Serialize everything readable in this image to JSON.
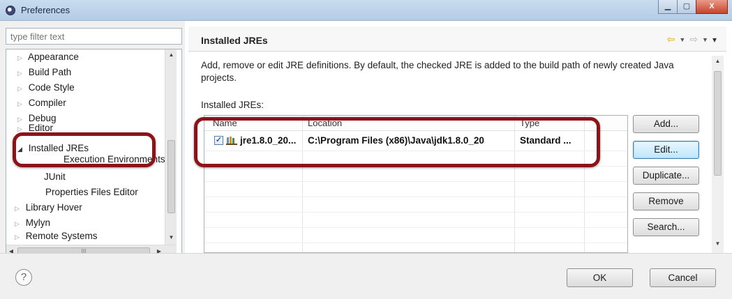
{
  "window": {
    "title": "Preferences",
    "minimize": "▁",
    "maximize": "▢",
    "close": "X"
  },
  "filter": {
    "placeholder": "type filter text"
  },
  "tree": {
    "items": [
      {
        "label": "Appearance",
        "expander": "▷"
      },
      {
        "label": "Build Path",
        "expander": "▷"
      },
      {
        "label": "Code Style",
        "expander": "▷"
      },
      {
        "label": "Compiler",
        "expander": "▷"
      },
      {
        "label": "Debug",
        "expander": "▷"
      },
      {
        "label": "Editor",
        "expander": "▷"
      },
      {
        "label": "Installed JREs",
        "expander": "◢"
      },
      {
        "label": "Execution Environments",
        "expander": ""
      },
      {
        "label": "JUnit",
        "expander": ""
      },
      {
        "label": "Properties Files Editor",
        "expander": ""
      },
      {
        "label": "Library Hover",
        "expander": "▷"
      },
      {
        "label": "Mylyn",
        "expander": "▷"
      },
      {
        "label": "Remote Systems",
        "expander": "▷"
      }
    ],
    "hscroll_grip": "III"
  },
  "page": {
    "title": "Installed JREs",
    "description": "Add, remove or edit JRE definitions. By default, the checked JRE is added to the build path of newly created Java projects.",
    "list_label": "Installed JREs:"
  },
  "table": {
    "columns": [
      "Name",
      "Location",
      "Type"
    ],
    "rows": [
      {
        "checked": "✓",
        "name": "jre1.8.0_20...",
        "location": "C:\\Program Files (x86)\\Java\\jdk1.8.0_20",
        "type": "Standard ..."
      }
    ]
  },
  "buttons": {
    "add": "Add...",
    "edit": "Edit...",
    "duplicate": "Duplicate...",
    "remove": "Remove",
    "search": "Search..."
  },
  "footer": {
    "help": "?",
    "ok": "OK",
    "cancel": "Cancel"
  },
  "colors": {
    "highlight": "#8c1318",
    "back_arrow": "#e2a800"
  },
  "icons": {
    "back": "⇦",
    "forward": "⇨",
    "dropdown": "▼",
    "menu": "▾"
  }
}
